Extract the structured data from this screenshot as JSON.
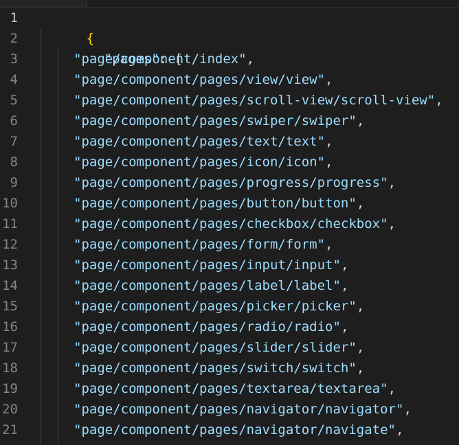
{
  "editor": {
    "line_numbers": [
      "1",
      "2",
      "3",
      "4",
      "5",
      "6",
      "7",
      "8",
      "9",
      "10",
      "11",
      "12",
      "13",
      "14",
      "15",
      "16",
      "17",
      "18",
      "19",
      "20",
      "21"
    ],
    "open_brace": "{",
    "pages_key": "\"pages\"",
    "colon_bracket": ": [",
    "entries": [
      "\"page/component/index\"",
      "\"page/component/pages/view/view\"",
      "\"page/component/pages/scroll-view/scroll-view\"",
      "\"page/component/pages/swiper/swiper\"",
      "\"page/component/pages/text/text\"",
      "\"page/component/pages/icon/icon\"",
      "\"page/component/pages/progress/progress\"",
      "\"page/component/pages/button/button\"",
      "\"page/component/pages/checkbox/checkbox\"",
      "\"page/component/pages/form/form\"",
      "\"page/component/pages/input/input\"",
      "\"page/component/pages/label/label\"",
      "\"page/component/pages/picker/picker\"",
      "\"page/component/pages/radio/radio\"",
      "\"page/component/pages/slider/slider\"",
      "\"page/component/pages/switch/switch\"",
      "\"page/component/pages/textarea/textarea\"",
      "\"page/component/pages/navigator/navigator\"",
      "\"page/component/pages/navigator/navigate\""
    ],
    "comma": ",",
    "colors": {
      "background": "#1e1e1e",
      "line_number": "#858585",
      "active_line_number": "#c6c6c6",
      "string": "#9cdcfe",
      "brace": "#ffd700"
    }
  }
}
